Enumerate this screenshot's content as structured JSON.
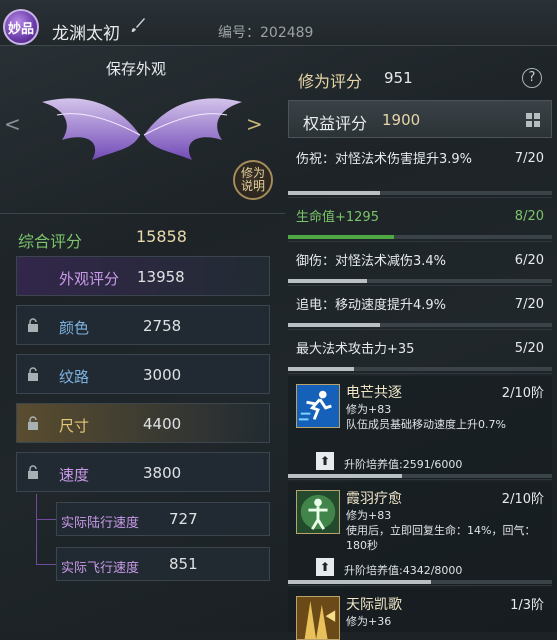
{
  "header": {
    "badge": "妙品",
    "title": "龙渊太初",
    "serial": "编号：202489"
  },
  "left": {
    "save_look": "保存外观",
    "info_button": "修为\n说明",
    "total": {
      "label": "综合评分",
      "value": "15858"
    },
    "rows": [
      {
        "label": "外观评分",
        "value": "13958"
      },
      {
        "label": "颜色",
        "value": "2758"
      },
      {
        "label": "纹路",
        "value": "3000"
      },
      {
        "label": "尺寸",
        "value": "4400"
      },
      {
        "label": "速度",
        "value": "3800"
      }
    ],
    "sub_rows": [
      {
        "label": "实际陆行速度",
        "value": "727"
      },
      {
        "label": "实际飞行速度",
        "value": "851"
      }
    ]
  },
  "right": {
    "header": {
      "label": "修为评分",
      "value": "951",
      "help": "?"
    },
    "rights": {
      "label": "权益评分",
      "value": "1900"
    },
    "attrs": [
      {
        "name": "伤祝：对怪法术伤害提升3.9%",
        "level": "7/20",
        "progress": 0.35,
        "color": "#e7eaec"
      },
      {
        "name": "生命值+1295",
        "level": "8/20",
        "progress": 0.4,
        "color": "#7bc46a"
      },
      {
        "name": "御伤：对怪法术减伤3.4%",
        "level": "6/20",
        "progress": 0.3,
        "color": "#e7eaec"
      },
      {
        "name": "追电：移动速度提升4.9%",
        "level": "7/20",
        "progress": 0.35,
        "color": "#e7eaec"
      },
      {
        "name": "最大法术攻击力+35",
        "level": "5/20",
        "progress": 0.25,
        "color": "#e7eaec"
      }
    ],
    "skills": [
      {
        "name": "电芒共逐",
        "level": "2/10阶",
        "desc1": "修为+83",
        "desc2": "队伍成员基础移动速度上升0.7%",
        "cult": "升阶培养值:2591/6000",
        "progress": 0.43,
        "icon": "running-figure-icon"
      },
      {
        "name": "霞羽疗愈",
        "level": "2/10阶",
        "desc1": "修为+83",
        "desc2": "使用后，立即回复生命：14%，回气：180秒",
        "cult": "升阶培养值:4342/8000",
        "progress": 0.54,
        "icon": "healing-figure-icon"
      },
      {
        "name": "天际凯歌",
        "level": "1/3阶",
        "desc1": "修为+36",
        "desc2": "",
        "cult": "",
        "progress": 0,
        "icon": "golden-banner-icon"
      }
    ]
  }
}
